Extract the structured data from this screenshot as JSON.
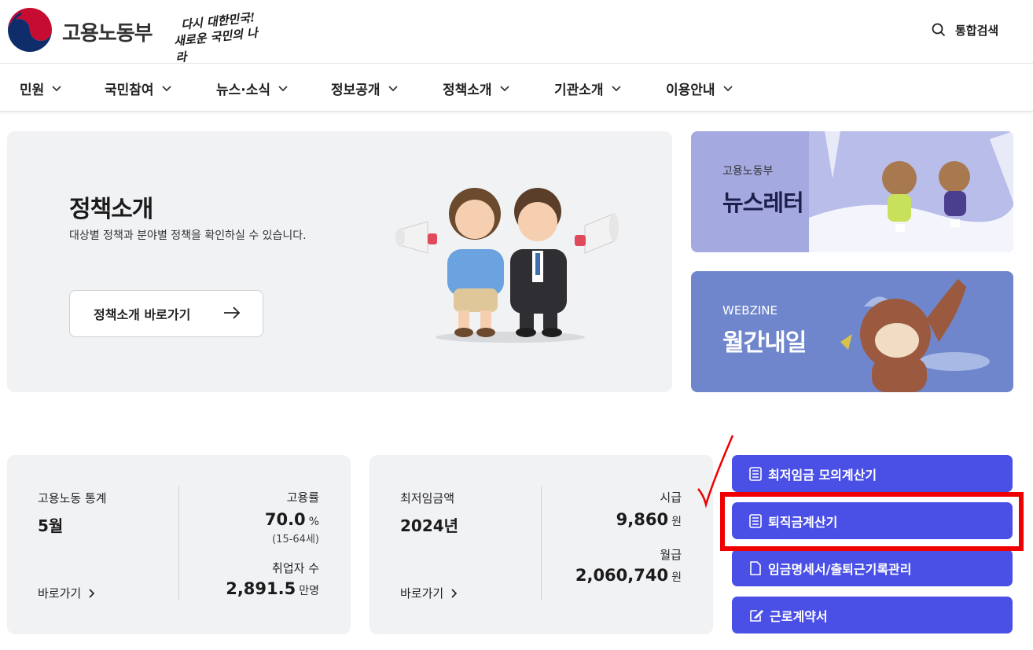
{
  "header": {
    "logo_text": "고용노동부",
    "slogan_line1": "다시 대한민국!",
    "slogan_line2": "새로운 국민의 나라",
    "search_label": "통합검색",
    "search_icon": "search-icon"
  },
  "nav": {
    "items": [
      {
        "label": "민원"
      },
      {
        "label": "국민참여"
      },
      {
        "label": "뉴스·소식"
      },
      {
        "label": "정보공개"
      },
      {
        "label": "정책소개"
      },
      {
        "label": "기관소개"
      },
      {
        "label": "이용안내"
      }
    ]
  },
  "policy": {
    "title": "정책소개",
    "description": "대상별 정책과 분야별 정책을 확인하실 수 있습니다.",
    "button_label": "정책소개 바로가기"
  },
  "newsletter": {
    "subtitle": "고용노동부",
    "title": "뉴스레터"
  },
  "webzine": {
    "subtitle": "WEBZINE",
    "title": "월간내일"
  },
  "stats": {
    "label": "고용노동 통계",
    "month": "5월",
    "more": "바로가기",
    "employment_rate_label": "고용률",
    "employment_rate_value": "70.0",
    "employment_rate_unit": "%",
    "employment_rate_note": "(15-64세)",
    "employed_label": "취업자 수",
    "employed_value": "2,891.5",
    "employed_unit": "만명"
  },
  "wage": {
    "label": "최저임금액",
    "year": "2024년",
    "more": "바로가기",
    "hourly_label": "시급",
    "hourly_value": "9,860",
    "hourly_unit": "원",
    "monthly_label": "월급",
    "monthly_value": "2,060,740",
    "monthly_unit": "원"
  },
  "tools": [
    {
      "label": "최저임금 모의계산기",
      "icon": "calculator-icon"
    },
    {
      "label": "퇴직금계산기",
      "icon": "calculator-icon"
    },
    {
      "label": "임금명세서/출퇴근기록관리",
      "icon": "document-icon"
    },
    {
      "label": "근로계약서",
      "icon": "edit-document-icon"
    }
  ],
  "colors": {
    "tool_button": "#4a50e6",
    "highlight": "#ee0000",
    "newsletter_bg": "#a4a9e0",
    "webzine_bg": "#6f86cc",
    "card_bg": "#f1f2f4"
  }
}
